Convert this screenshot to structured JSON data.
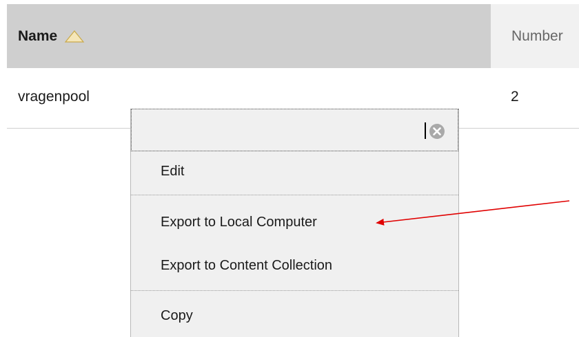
{
  "table": {
    "headers": {
      "name": "Name",
      "number": "Number"
    },
    "rows": [
      {
        "name": "vragenpool",
        "number": "2"
      }
    ]
  },
  "context_menu": {
    "items": [
      {
        "label": "Edit"
      },
      {
        "label": "Export to Local Computer"
      },
      {
        "label": "Export to Content Collection"
      },
      {
        "label": "Copy"
      }
    ]
  },
  "colors": {
    "header_active_bg": "#cfcfcf",
    "header_inactive_bg": "#f1f1f1",
    "menu_bg": "#f0f0f0",
    "annotation_arrow": "#e00000",
    "sort_icon": "#f5e6b8"
  },
  "icons": {
    "sort": "sort-ascending-icon",
    "close": "close-icon",
    "annotation": "annotation-arrow-icon"
  }
}
